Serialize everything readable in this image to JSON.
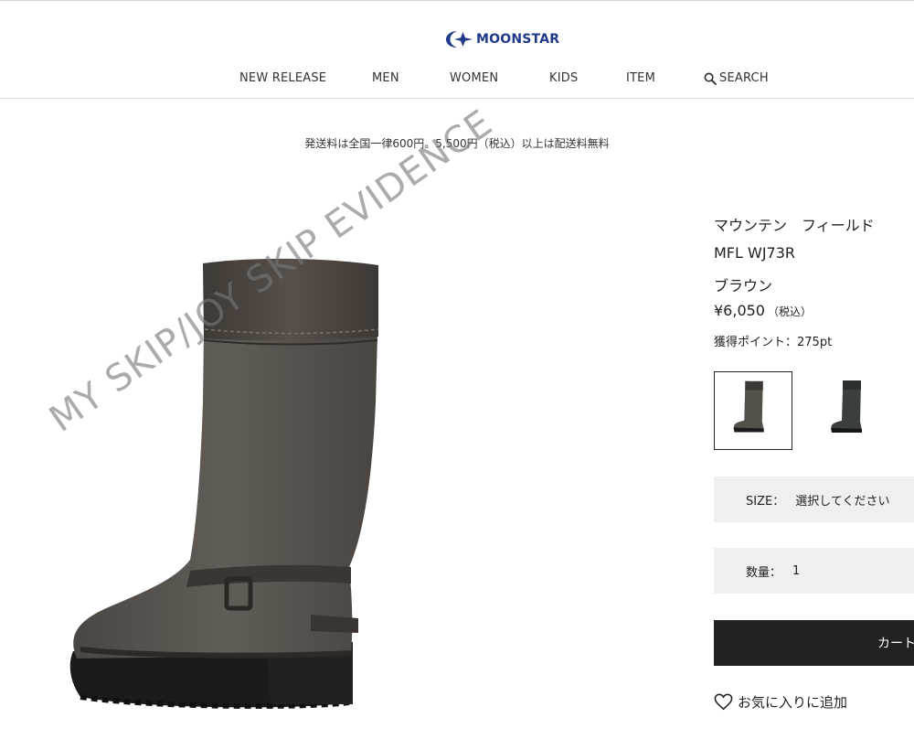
{
  "header": {
    "logo_text": "MOONSTAR",
    "brand_color": "#1f3a8a",
    "nav": [
      {
        "label": "NEW RELEASE"
      },
      {
        "label": "MEN"
      },
      {
        "label": "WOMEN"
      },
      {
        "label": "KIDS"
      },
      {
        "label": "ITEM"
      },
      {
        "label": "SEARCH",
        "icon": "search-icon"
      }
    ]
  },
  "notice": {
    "shipping": "発送料は全国一律600円。5,500円（税込）以上は配送料無料"
  },
  "watermark": "MY SKIP/JOY SKIP EVIDENCE",
  "product": {
    "name": "マウンテン　フィールド",
    "code": "MFL WJ73R",
    "color": "ブラウン",
    "price": "¥6,050",
    "tax_note": "（税込）",
    "points": "獲得ポイント：275pt",
    "swatches": [
      {
        "color_name": "brown",
        "hex": "#56504b",
        "selected": true
      },
      {
        "color_name": "dark-green",
        "hex": "#3a3f3b",
        "selected": false
      }
    ],
    "size": {
      "label": "SIZE：",
      "value": "選択してください"
    },
    "quantity": {
      "label": "数量：",
      "value": "1"
    },
    "cart_button": "カートに入",
    "favorite": "お気に入りに追加"
  }
}
